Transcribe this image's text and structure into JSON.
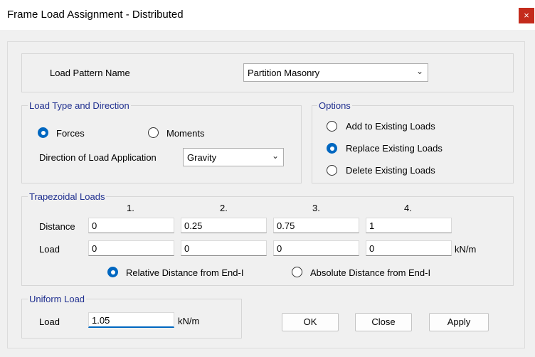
{
  "window": {
    "title": "Frame Load Assignment - Distributed",
    "close_glyph": "×"
  },
  "load_pattern": {
    "label": "Load Pattern Name",
    "value": "Partition Masonry"
  },
  "load_type": {
    "legend": "Load Type and Direction",
    "forces_label": "Forces",
    "forces_checked": true,
    "moments_label": "Moments",
    "moments_checked": false,
    "direction_label": "Direction of Load Application",
    "direction_value": "Gravity"
  },
  "options": {
    "legend": "Options",
    "add_label": "Add to Existing Loads",
    "replace_label": "Replace Existing Loads",
    "delete_label": "Delete Existing Loads",
    "selected": "replace"
  },
  "trapezoidal": {
    "legend": "Trapezoidal Loads",
    "columns": [
      "1.",
      "2.",
      "3.",
      "4."
    ],
    "distance_label": "Distance",
    "load_label": "Load",
    "distances": [
      "0",
      "0.25",
      "0.75",
      "1"
    ],
    "loads": [
      "0",
      "0",
      "0",
      "0"
    ],
    "load_unit": "kN/m",
    "relative_label": "Relative Distance from End-I",
    "absolute_label": "Absolute Distance from End-I",
    "selected": "relative"
  },
  "uniform": {
    "legend": "Uniform Load",
    "load_label": "Load",
    "value": "1.05",
    "unit": "kN/m"
  },
  "buttons": {
    "ok": "OK",
    "close": "Close",
    "apply": "Apply"
  },
  "colors": {
    "accent": "#0067c0",
    "legend_text": "#1f2f8f",
    "close_button": "#c42b1c",
    "background": "#f0f0f0"
  }
}
